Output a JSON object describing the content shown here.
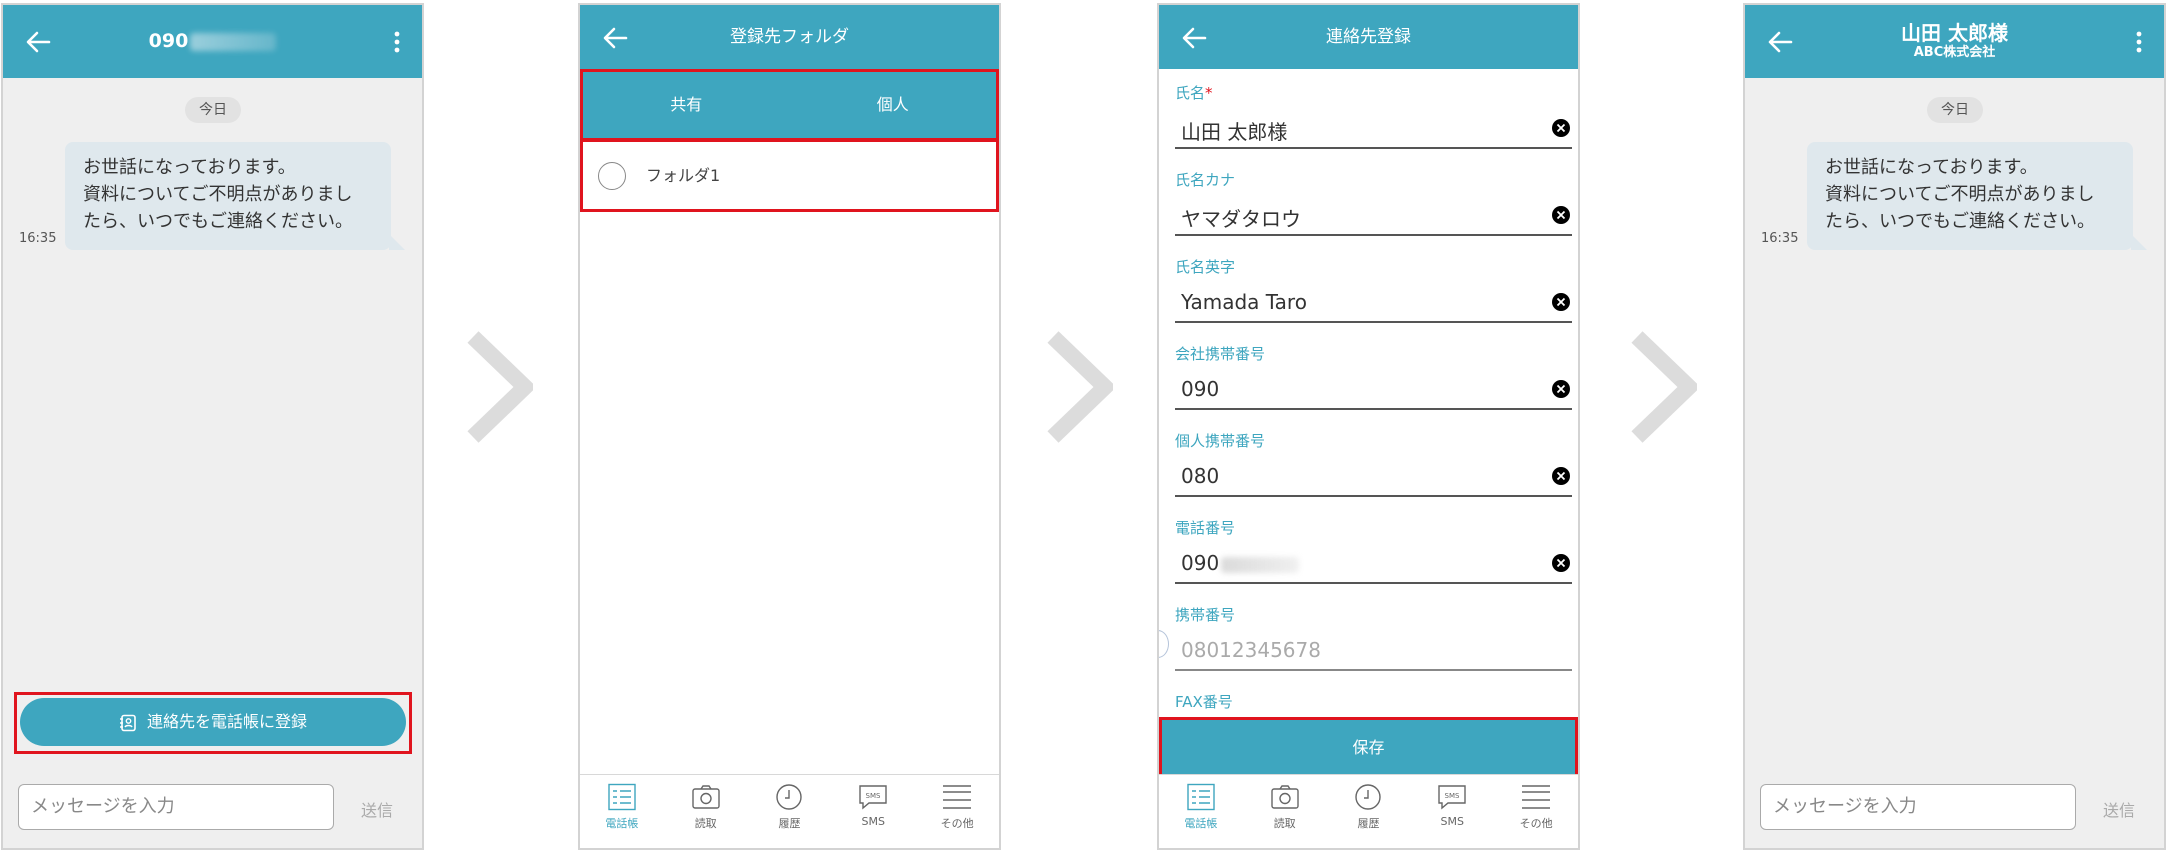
{
  "colors": {
    "accent": "#3ea6bf",
    "highlight": "#e0141e",
    "bubble": "#dfe8ed"
  },
  "chat": {
    "number_prefix": "090",
    "date_chip": "今日",
    "message_lines": [
      "お世話になっております。",
      "資料についてご不明点がありまし",
      "たら、いつでもご連絡ください。"
    ],
    "message_time": "16:35",
    "register_button": "連絡先を電話帳に登録",
    "composer_placeholder": "メッセージを入力",
    "send_label": "送信"
  },
  "folder": {
    "title": "登録先フォルダ",
    "tabs": [
      "共有",
      "個人"
    ],
    "folder_item": "フォルダ1"
  },
  "nav": {
    "items": [
      {
        "label": "電話帳",
        "icon": "phonebook-icon"
      },
      {
        "label": "読取",
        "icon": "camera-icon"
      },
      {
        "label": "履歴",
        "icon": "clock-icon"
      },
      {
        "label": "SMS",
        "icon": "sms-icon"
      },
      {
        "label": "その他",
        "icon": "menu-icon"
      }
    ]
  },
  "contact": {
    "title": "連絡先登録",
    "fields": [
      {
        "label": "氏名",
        "value": "山田 太郎様"
      },
      {
        "label": "氏名カナ",
        "value": "ヤマダタロウ"
      },
      {
        "label": "氏名英字",
        "value": "Yamada Taro"
      },
      {
        "label": "会社携帯番号",
        "value": "090"
      },
      {
        "label": "個人携帯番号",
        "value": "080"
      },
      {
        "label": "電話番号",
        "value": "090"
      },
      {
        "label": "携帯番号",
        "placeholder": "08012345678"
      },
      {
        "label": "FAX番号"
      }
    ],
    "required_mark": "*",
    "save_label": "保存"
  },
  "registered": {
    "name": "山田 太郎様",
    "company": "ABC株式会社",
    "date_chip": "今日",
    "message_lines": [
      "お世話になっております。",
      "資料についてご不明点がありまし",
      "たら、いつでもご連絡ください。"
    ],
    "message_time": "16:35",
    "composer_placeholder": "メッセージを入力",
    "send_label": "送信"
  }
}
